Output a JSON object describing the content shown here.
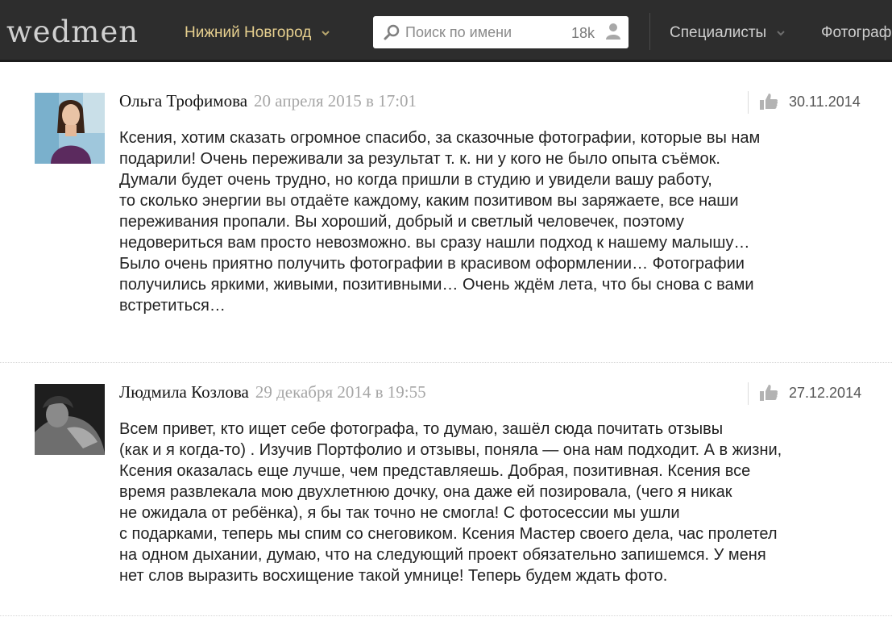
{
  "header": {
    "logo": "wedmen",
    "city": "Нижний Новгород",
    "search": {
      "placeholder": "Поиск по имени",
      "count": "18k"
    },
    "nav": {
      "specialists": "Специалисты",
      "photographers": "Фотограф"
    }
  },
  "reviews": [
    {
      "author": "Ольга Трофимова",
      "date": "20 апреля 2015 в 17:01",
      "event_date": "30.11.2014",
      "text": "Ксения, хотим сказать огромное спасибо, за сказочные фотографии, которые вы нам\nподарили! Очень переживали за результат т. к. ни у кого не было опыта съёмок.\nДумали будет очень трудно, но когда пришли в студию и увидели вашу работу,\nто сколько энергии вы отдаёте каждому, каким позитивом вы заряжаете, все наши\nпереживания пропали. Вы хороший, добрый и светлый человечек, поэтому\nнедовериться вам просто невозможно. вы сразу нашли подход к нашему малышу…\nБыло очень приятно получить фотографии в красивом оформлении… Фотографии\nполучились яркими, живыми, позитивными… Очень ждём лета, что бы снова с вами\nвстретиться…"
    },
    {
      "author": "Людмила Козлова",
      "date": "29 декабря 2014 в 19:55",
      "event_date": "27.12.2014",
      "text": "Всем привет, кто ищет себе фотографа, то думаю, зашёл сюда почитать отзывы\n(как и я когда-то) . Изучив Портфолио и отзывы, поняла — она нам подходит. А в жизни,\nКсения оказалась еще лучше, чем представляешь. Добрая, позитивная. Ксения все\nвремя развлекала мою двухлетнюю дочку, она даже ей позировала, (чего я никак\nне ожидала от ребёнка), я бы так точно не смогла! С фотосессии мы ушли\nс подарками, теперь мы спим со снеговиком. Ксения Мастер своего дела, час пролетел\nна одном дыхании, думаю, что на следующий проект обязательно запишемся. У меня\nнет слов выразить восхищение такой умнице! Теперь будем ждать фото."
    }
  ],
  "colors": {
    "header_bg": "#2d2d2d",
    "city": "#e7d08f",
    "date_gray": "#a6a6a6"
  },
  "icons": [
    "chevron-down-icon",
    "search-icon",
    "user-icon",
    "thumbs-up-icon"
  ]
}
